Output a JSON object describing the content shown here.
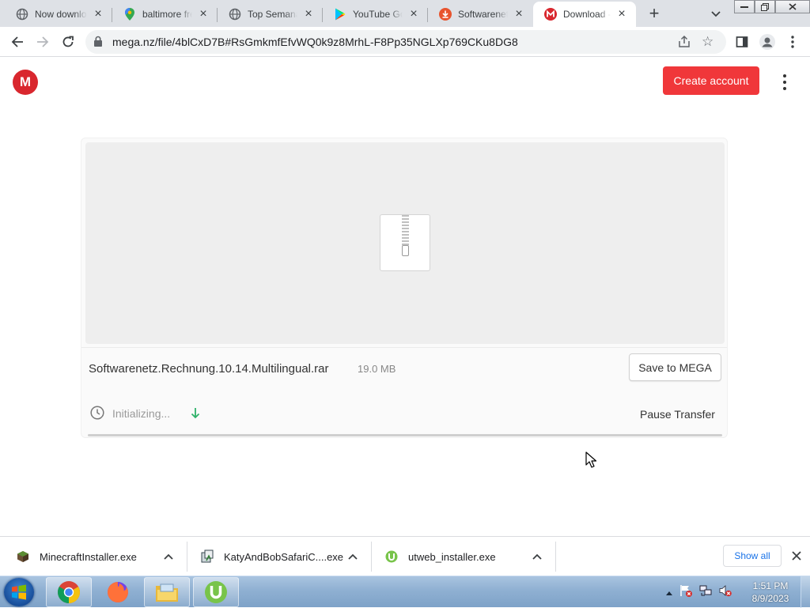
{
  "browser": {
    "tabs": [
      {
        "title": "Now downloading",
        "icon": "globe-icon"
      },
      {
        "title": "baltimore free",
        "icon": "maps-pin-icon"
      },
      {
        "title": "Top Semanal",
        "icon": "globe-icon"
      },
      {
        "title": "YouTube Go -",
        "icon": "play-store-icon"
      },
      {
        "title": "Softwarenetz",
        "icon": "download-site-icon"
      },
      {
        "title": "Download - MEGA",
        "icon": "mega-icon",
        "active": true
      }
    ],
    "url": "mega.nz/file/4blCxD7B#RsGmkmfEfvWQ0k9z8MrhL-F8Pp35NGLXp769CKu8DG8"
  },
  "page": {
    "logo_text": "M",
    "create_account": "Create account",
    "file": {
      "name": "Softwarenetz.Rechnung.10.14.Multilingual.rar",
      "size": "19.0 MB",
      "save_label": "Save to MEGA",
      "status": "Initializing...",
      "pause_label": "Pause Transfer",
      "progress": 0
    },
    "colors": {
      "brand": "#d9272e",
      "accent": "#f0373a",
      "progress": "#2ba6de"
    }
  },
  "downloads": {
    "items": [
      {
        "name": "MinecraftInstaller.exe",
        "icon": "minecraft-icon"
      },
      {
        "name": "KatyAndBobSafariC....exe",
        "icon": "installer-icon"
      },
      {
        "name": "utweb_installer.exe",
        "icon": "utorrent-icon"
      }
    ],
    "show_all": "Show all"
  },
  "taskbar": {
    "apps": [
      "chrome-icon",
      "firefox-icon",
      "explorer-icon",
      "utorrent-icon"
    ],
    "time": "1:51 PM",
    "date": "8/9/2023"
  }
}
